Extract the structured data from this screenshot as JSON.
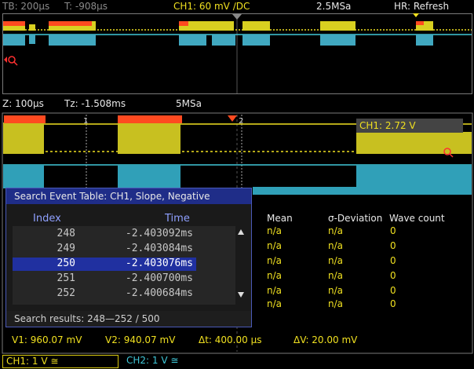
{
  "header": {
    "timebase": "TB: 200µs",
    "trigger_time": "T: -908µs",
    "channel": "CH1: 60 mV ∕DC",
    "sample_rate": "2.5MSa",
    "hr_mode": "HR: Refresh"
  },
  "zoom_header": {
    "zoom": "Z: 100µs",
    "zoom_time": "Tz: -1.508ms",
    "zoom_rate": "5MSa"
  },
  "overlay": {
    "ch1_level": "CH1: 2.72 V",
    "cursor_mark_1": "1",
    "cursor_mark_2": "2"
  },
  "search_table": {
    "title": "Search Event Table: CH1, Slope, Negative",
    "col_index": "Index",
    "col_time": "Time",
    "rows": [
      {
        "index": "248",
        "time": "-2.403092ms"
      },
      {
        "index": "249",
        "time": "-2.403084ms"
      },
      {
        "index": "250",
        "time": "-2.403076ms"
      },
      {
        "index": "251",
        "time": "-2.400700ms"
      },
      {
        "index": "252",
        "time": "-2.400684ms"
      }
    ],
    "selected_row": 2,
    "results": "Search results:  248—252 / 500"
  },
  "measurements": {
    "col_mean": "Mean",
    "col_sigma": "σ-Deviation",
    "col_wave": "Wave count",
    "rows": [
      {
        "mean": "n/a",
        "sigma": "n/a",
        "wave": "0"
      },
      {
        "mean": "n/a",
        "sigma": "n/a",
        "wave": "0"
      },
      {
        "mean": "n/a",
        "sigma": "n/a",
        "wave": "0"
      },
      {
        "mean": "n/a",
        "sigma": "n/a",
        "wave": "0"
      },
      {
        "mean": "n/a",
        "sigma": "n/a",
        "wave": "0"
      },
      {
        "mean": "n/a",
        "sigma": "n/a",
        "wave": "0"
      }
    ]
  },
  "cursors": {
    "v1": "V1: 960.07 mV",
    "v2": "V2: 940.07 mV",
    "dt": "Δt: 400.00 µs",
    "dv": "ΔV: 20.00 mV"
  },
  "channels": {
    "ch1": "CH1: 1 V ≅",
    "ch2": "CH2: 1 V ≅"
  },
  "colors": {
    "ch1": "#f0e020",
    "ch2": "#40c8d8",
    "marker": "#ff4a20",
    "selection": "#2030a0"
  }
}
